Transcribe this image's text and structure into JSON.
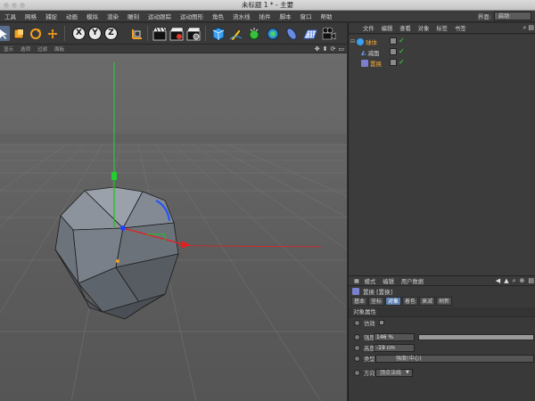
{
  "window": {
    "title": "未标题 1 * - 主要"
  },
  "menubar": {
    "items": [
      "工具",
      "网格",
      "捕捉",
      "动画",
      "模拟",
      "渲染",
      "雕刻",
      "运动跟踪",
      "运动图形",
      "角色",
      "流水线",
      "插件",
      "脚本",
      "窗口",
      "帮助"
    ],
    "layout_label": "界面:",
    "layout_value": "启动"
  },
  "toolbar": {
    "axis": [
      "X",
      "Y",
      "Z"
    ]
  },
  "viewport": {
    "menu": [
      "显示",
      "选项",
      "过滤",
      "面板"
    ]
  },
  "object_manager": {
    "menu": [
      "文件",
      "编辑",
      "查看",
      "对象",
      "标签",
      "书签"
    ],
    "objects": [
      {
        "name": "球体",
        "color": "#f3a83a"
      },
      {
        "name": "减面",
        "color": "#d9d9d9"
      },
      {
        "name": "置换",
        "color": "#f3a83a"
      }
    ]
  },
  "attributes": {
    "menu": [
      "模式",
      "编辑",
      "用户数据"
    ],
    "title": "置换 [置换]",
    "tabs": [
      "基本",
      "坐标",
      "对象",
      "着色",
      "衰减",
      "刷新"
    ],
    "active_tab": 2,
    "section": "对象属性",
    "props": {
      "imitate_label": "仿效",
      "strength_label": "强度",
      "strength_value": "146 %",
      "strength_fraction": 1.0,
      "height_label": "高度",
      "height_value": "-19 cm",
      "type_label": "类型",
      "type_value": "强度(中心)",
      "direction_label": "方向",
      "direction_value": "顶点法线"
    }
  },
  "colors": {
    "axis_x": "#e02020",
    "axis_y": "#20c020",
    "axis_z": "#2050ff",
    "selected": "#5a6f8f"
  }
}
